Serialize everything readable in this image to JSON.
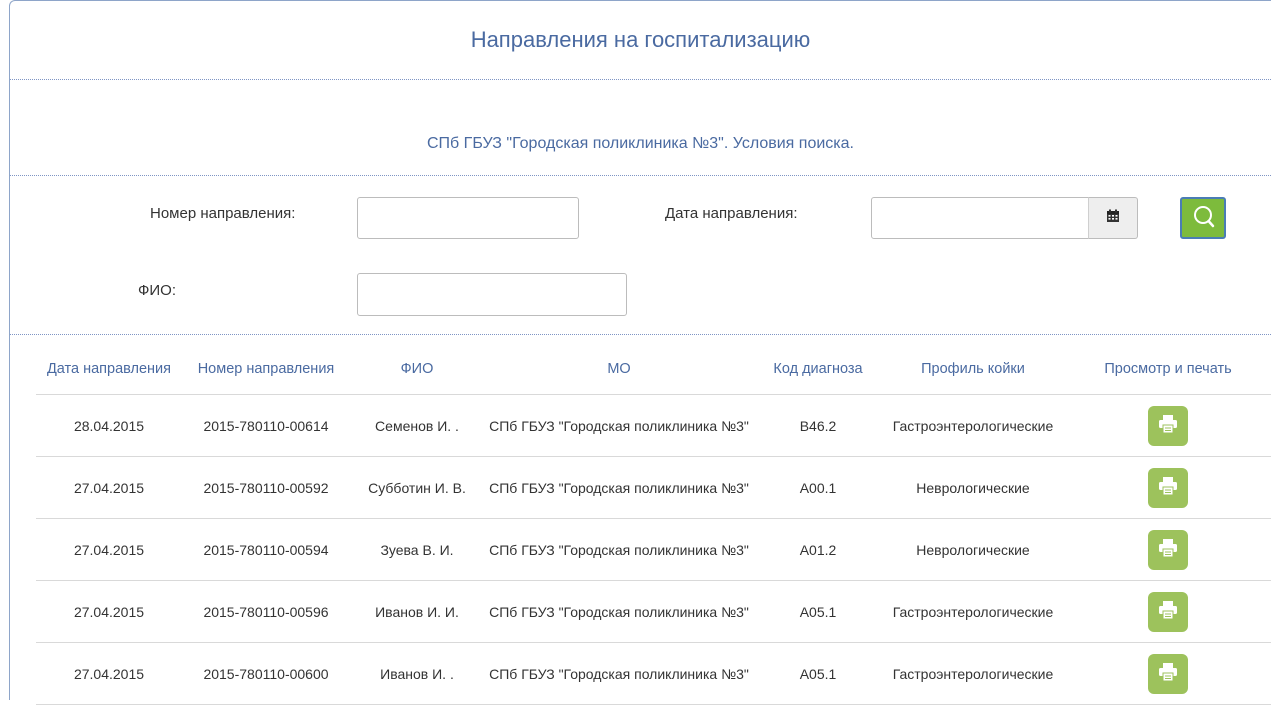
{
  "header": {
    "title": "Направления на госпитализацию"
  },
  "search": {
    "heading": "СПб ГБУЗ \"Городская поликлиника №3\". Условия поиска.",
    "number_label": "Номер направления:",
    "number_value": "",
    "date_label": "Дата направления:",
    "date_value": "",
    "fio_label": "ФИО:",
    "fio_value": ""
  },
  "icons": {
    "calendar": "calendar-icon",
    "search": "search-icon",
    "print": "printer-icon"
  },
  "colors": {
    "accent_blue": "#4a6aa1",
    "search_green": "#7dbb3c",
    "print_green": "#9dc25c"
  },
  "table": {
    "columns": [
      "Дата направления",
      "Номер направления",
      "ФИО",
      "МО",
      "Код диагноза",
      "Профиль койки",
      "Просмотр и печать"
    ],
    "rows": [
      {
        "date": "28.04.2015",
        "number": "2015-780110-00614",
        "fio": "Семенов И. .",
        "mo": "СПб ГБУЗ \"Городская поликлиника №3\"",
        "code": "B46.2",
        "profile": "Гастроэнтерологические"
      },
      {
        "date": "27.04.2015",
        "number": "2015-780110-00592",
        "fio": "Субботин И. В.",
        "mo": "СПб ГБУЗ \"Городская поликлиника №3\"",
        "code": "A00.1",
        "profile": "Неврологические"
      },
      {
        "date": "27.04.2015",
        "number": "2015-780110-00594",
        "fio": "Зуева В. И.",
        "mo": "СПб ГБУЗ \"Городская поликлиника №3\"",
        "code": "A01.2",
        "profile": "Неврологические"
      },
      {
        "date": "27.04.2015",
        "number": "2015-780110-00596",
        "fio": "Иванов И. И.",
        "mo": "СПб ГБУЗ \"Городская поликлиника №3\"",
        "code": "A05.1",
        "profile": "Гастроэнтерологические"
      },
      {
        "date": "27.04.2015",
        "number": "2015-780110-00600",
        "fio": "Иванов И. .",
        "mo": "СПб ГБУЗ \"Городская поликлиника №3\"",
        "code": "A05.1",
        "profile": "Гастроэнтерологические"
      }
    ]
  }
}
